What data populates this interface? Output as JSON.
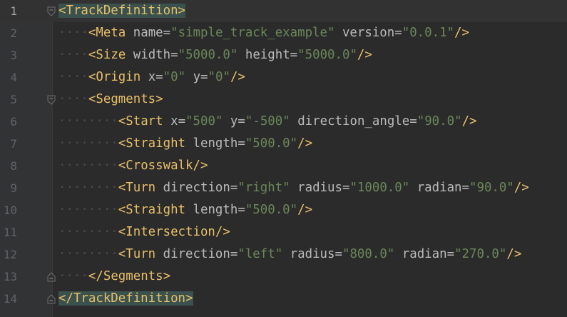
{
  "editor": {
    "lines": [
      {
        "num": "1"
      },
      {
        "num": "2"
      },
      {
        "num": "3"
      },
      {
        "num": "4"
      },
      {
        "num": "5"
      },
      {
        "num": "6"
      },
      {
        "num": "7"
      },
      {
        "num": "8"
      },
      {
        "num": "9"
      },
      {
        "num": "10"
      },
      {
        "num": "11"
      },
      {
        "num": "12"
      },
      {
        "num": "13"
      },
      {
        "num": "14"
      }
    ],
    "code": {
      "l1": {
        "open": "<",
        "tag": "TrackDefinition",
        "close": ">"
      },
      "l2": {
        "tag": "Meta",
        "a1": "name",
        "v1": "\"simple_track_example\"",
        "a2": "version",
        "v2": "\"0.0.1\""
      },
      "l3": {
        "tag": "Size",
        "a1": "width",
        "v1": "\"5000.0\"",
        "a2": "height",
        "v2": "\"5000.0\""
      },
      "l4": {
        "tag": "Origin",
        "a1": "x",
        "v1": "\"0\"",
        "a2": "y",
        "v2": "\"0\""
      },
      "l5": {
        "tag": "Segments"
      },
      "l6": {
        "tag": "Start",
        "a1": "x",
        "v1": "\"500\"",
        "a2": "y",
        "v2": "\"-500\"",
        "a3": "direction_angle",
        "v3": "\"90.0\""
      },
      "l7": {
        "tag": "Straight",
        "a1": "length",
        "v1": "\"500.0\""
      },
      "l8": {
        "tag": "Crosswalk"
      },
      "l9": {
        "tag": "Turn",
        "a1": "direction",
        "v1": "\"right\"",
        "a2": "radius",
        "v2": "\"1000.0\"",
        "a3": "radian",
        "v3": "\"90.0\""
      },
      "l10": {
        "tag": "Straight",
        "a1": "length",
        "v1": "\"500.0\""
      },
      "l11": {
        "tag": "Intersection"
      },
      "l12": {
        "tag": "Turn",
        "a1": "direction",
        "v1": "\"left\"",
        "a2": "radius",
        "v2": "\"800.0\"",
        "a3": "radian",
        "v3": "\"270.0\""
      },
      "l13": {
        "tag": "Segments"
      },
      "l14": {
        "tag": "TrackDefinition"
      }
    }
  },
  "colors": {
    "background": "#2b2b2b",
    "gutter": "#313335",
    "tag": "#e8bf6a",
    "attribute": "#bababa",
    "value": "#6a8759",
    "line_number": "#606366",
    "matched_tag_highlight": "#3b514d"
  },
  "icons": {
    "fold_open": "fold-open-icon",
    "fold_close": "fold-close-icon"
  }
}
